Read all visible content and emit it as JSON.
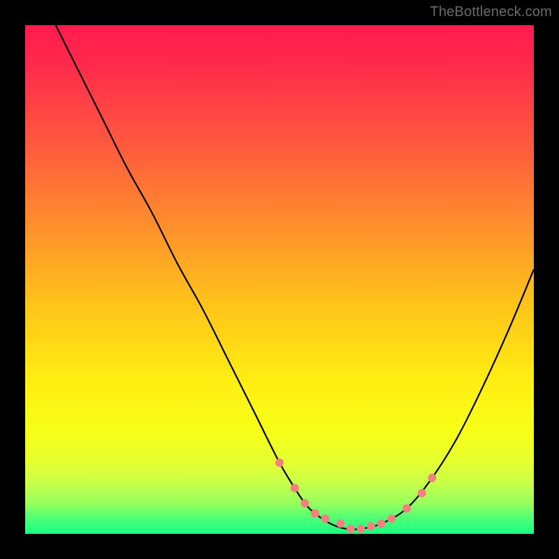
{
  "attribution": "TheBottleneck.com",
  "colors": {
    "page_bg": "#000000",
    "gradient_top": "#ff1a4e",
    "gradient_mid": "#ffee12",
    "gradient_bottom": "#18ff86",
    "curve": "#000000",
    "dots": "#f28080"
  },
  "chart_data": {
    "type": "line",
    "title": "",
    "xlabel": "",
    "ylabel": "",
    "xlim": [
      0,
      100
    ],
    "ylim": [
      0,
      100
    ],
    "grid": false,
    "legend": false,
    "annotations": [],
    "series": [
      {
        "name": "curve",
        "x": [
          6,
          10,
          15,
          20,
          25,
          30,
          35,
          40,
          45,
          50,
          53,
          55,
          57,
          60,
          63,
          66,
          70,
          75,
          80,
          85,
          90,
          95,
          100
        ],
        "y": [
          100,
          92,
          82,
          72,
          63,
          53,
          44,
          34,
          24,
          14,
          9,
          6,
          4,
          2,
          1,
          1,
          2,
          5,
          11,
          19,
          29,
          40,
          52
        ]
      }
    ],
    "markers": {
      "name": "highlight-dots",
      "x": [
        50,
        53,
        55,
        57,
        59,
        62,
        64,
        66,
        68,
        70,
        72,
        75,
        78,
        80
      ],
      "y": [
        14,
        9,
        6,
        4,
        3,
        2,
        1,
        1,
        1.5,
        2,
        3,
        5,
        8,
        11
      ]
    }
  }
}
